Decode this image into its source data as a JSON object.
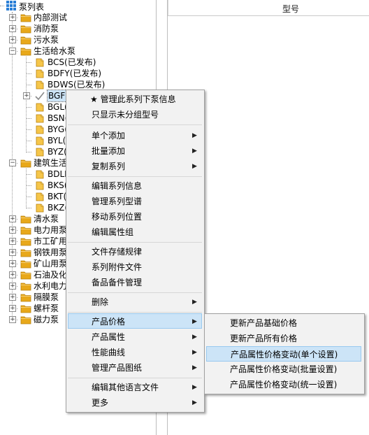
{
  "tree": {
    "root_label": "泵列表",
    "nodes": [
      {
        "label": "内部测试"
      },
      {
        "label": "消防泵"
      },
      {
        "label": "污水泵"
      },
      {
        "label": "生活给水泵"
      },
      {
        "label": "BCS(已发布)"
      },
      {
        "label": "BDFY(已发布)"
      },
      {
        "label": "BDWS(已发布)"
      },
      {
        "label": "BGF("
      },
      {
        "label": "BGL("
      },
      {
        "label": "BSN("
      },
      {
        "label": "BYG("
      },
      {
        "label": "BYL("
      },
      {
        "label": "BYZ("
      },
      {
        "label": "建筑生活"
      },
      {
        "label": "BDLL"
      },
      {
        "label": "BKS("
      },
      {
        "label": "BKT("
      },
      {
        "label": "BKZ("
      },
      {
        "label": "清水泵"
      },
      {
        "label": "电力用泵"
      },
      {
        "label": "市工矿用"
      },
      {
        "label": "钢铁用泵"
      },
      {
        "label": "矿山用泵"
      },
      {
        "label": "石油及化"
      },
      {
        "label": "水利电力"
      },
      {
        "label": "隔膜泵"
      },
      {
        "label": "螺杆泵"
      },
      {
        "label": "磁力泵"
      }
    ]
  },
  "panel": {
    "column_model": "型号"
  },
  "context_menu": {
    "items": [
      "★ 管理此系列下泵信息",
      "只显示未分组型号",
      "单个添加",
      "批量添加",
      "复制系列",
      "编辑系列信息",
      "管理系列型谱",
      "移动系列位置",
      "编辑属性组",
      "文件存储规律",
      "系列附件文件",
      "备品备件管理",
      "删除",
      "产品价格",
      "产品属性",
      "性能曲线",
      "管理产品图纸",
      "编辑其他语言文件",
      "更多"
    ]
  },
  "submenu": {
    "items": [
      "更新产品基础价格",
      "更新产品所有价格",
      "产品属性价格变动(单个设置)",
      "产品属性价格变动(批量设置)",
      "产品属性价格变动(统一设置)"
    ]
  },
  "colors": {
    "folder": "#e8a81a",
    "highlight": "#cce4f7",
    "grid_blue": "#2a7fd6"
  }
}
